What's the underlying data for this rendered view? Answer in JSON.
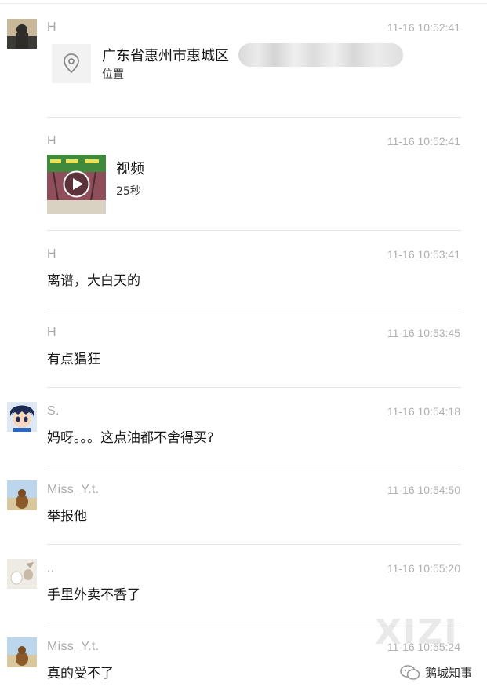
{
  "messages": [
    {
      "sender": "H",
      "time": "11-16 10:52:41",
      "type": "location",
      "location": {
        "title": "广东省惠州市惠城区",
        "subtitle": "位置",
        "icon": "location-pin-icon"
      }
    },
    {
      "sender": "H",
      "time": "11-16 10:52:41",
      "type": "video",
      "video": {
        "title": "视频",
        "duration": "25秒",
        "icon": "play-icon"
      }
    },
    {
      "sender": "H",
      "time": "11-16 10:53:41",
      "type": "text",
      "text": "离谱，大白天的"
    },
    {
      "sender": "H",
      "time": "11-16 10:53:45",
      "type": "text",
      "text": "有点猖狂"
    },
    {
      "sender": "S.",
      "time": "11-16 10:54:18",
      "type": "text",
      "text": "妈呀。。。这点油都不舍得买?"
    },
    {
      "sender": "Miss_Y.t.",
      "time": "11-16 10:54:50",
      "type": "text",
      "text": "举报他"
    },
    {
      "sender": "..",
      "time": "11-16 10:55:20",
      "type": "text",
      "text": "手里外卖不香了"
    },
    {
      "sender": "Miss_Y.t.",
      "time": "11-16 10:55:24",
      "type": "text",
      "text": "真的受不了"
    }
  ],
  "watermark": {
    "text": "XIZI",
    "brand": "鹅城知事",
    "icon": "wechat-icon"
  },
  "colors": {
    "sender": "#a8a8a8",
    "time": "#b0b0b0",
    "divider": "#e6e6e6",
    "text": "#1a1a1a"
  }
}
